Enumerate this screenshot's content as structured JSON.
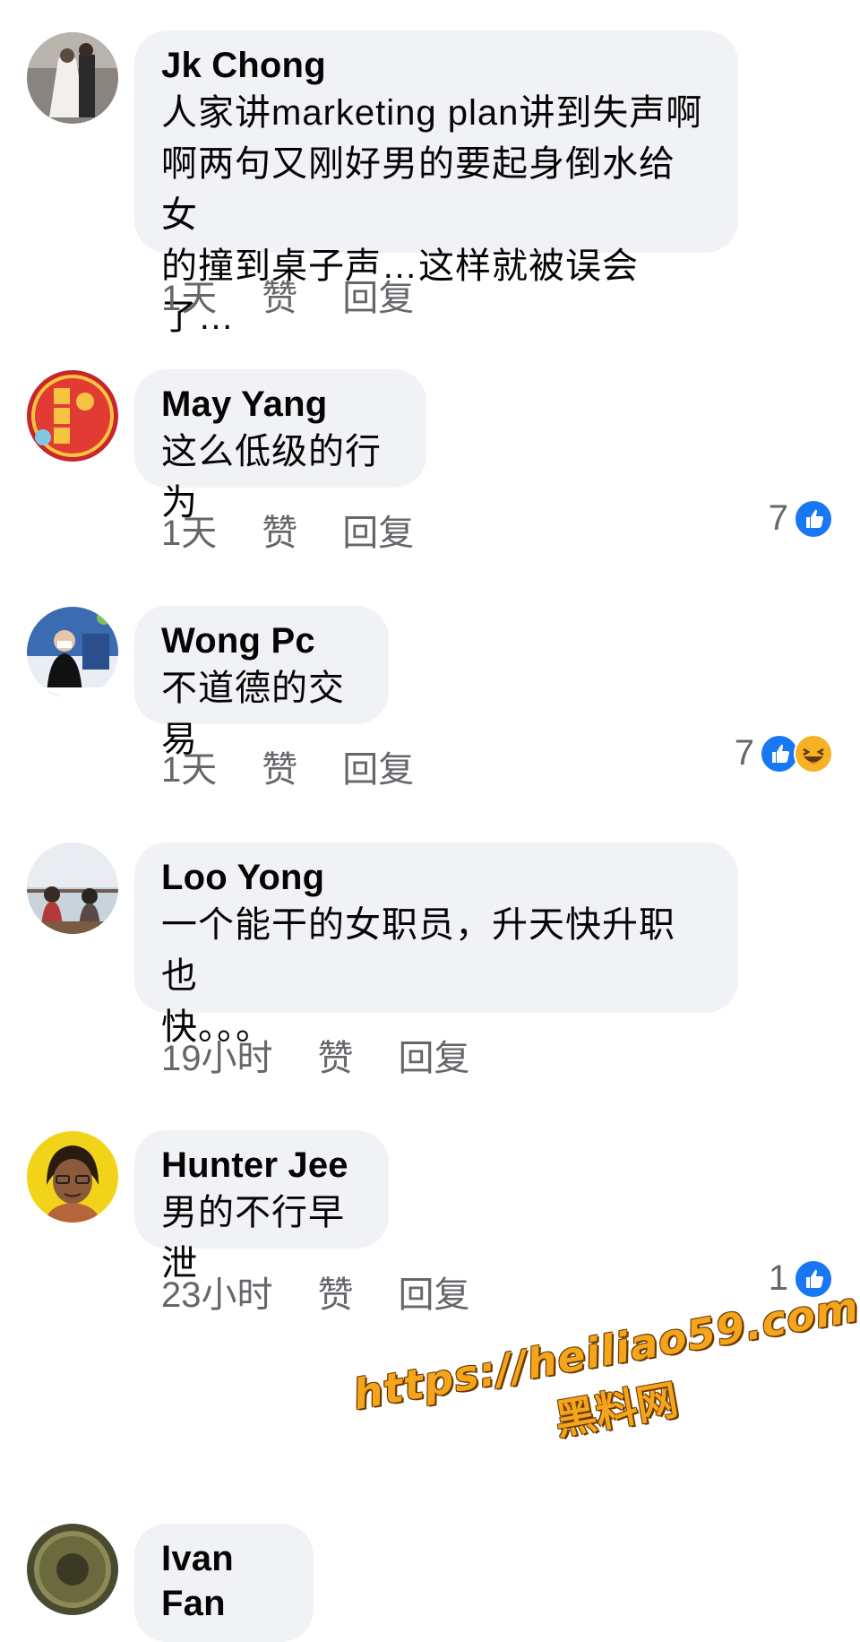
{
  "comments": [
    {
      "author": "Jk Chong",
      "text": "人家讲marketing plan讲到失声啊\n啊两句又刚好男的要起身倒水给女\n的撞到桌子声…这样就被误会了…",
      "time": "1天",
      "like_label": "赞",
      "reply_label": "回复",
      "reaction_count": ""
    },
    {
      "author": "May Yang",
      "text": "这么低级的行为",
      "time": "1天",
      "like_label": "赞",
      "reply_label": "回复",
      "reaction_count": "7"
    },
    {
      "author": "Wong Pc",
      "text": "不道德的交易",
      "time": "1天",
      "like_label": "赞",
      "reply_label": "回复",
      "reaction_count": "7"
    },
    {
      "author": "Loo Yong",
      "text": "一个能干的女职员，升天快升职也\n快。。。",
      "time": "19小时",
      "like_label": "赞",
      "reply_label": "回复",
      "reaction_count": ""
    },
    {
      "author": "Hunter Jee",
      "text": "男的不行早泄",
      "time": "23小时",
      "like_label": "赞",
      "reply_label": "回复",
      "reaction_count": "1"
    },
    {
      "author": "Ivan Fan",
      "text": ""
    }
  ],
  "icons": {
    "like": "like-icon",
    "haha": "haha-icon"
  },
  "colors": {
    "bubble": "#f0f2f5",
    "meta_text": "#65676b",
    "like_blue": "#1877f2",
    "haha_yellow": "#f7b125",
    "watermark": "#f4a51c"
  },
  "watermark": {
    "url": "https://heiliao59.com",
    "name": "黑料网"
  }
}
